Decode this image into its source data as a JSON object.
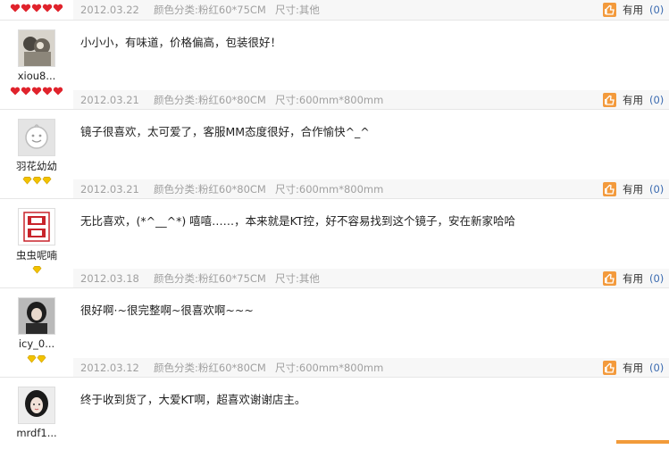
{
  "reviews": [
    {
      "username": "",
      "rank": {
        "type": "heart",
        "count": 5
      },
      "content": "",
      "meta": {
        "date": "2012.03.22",
        "color": "颜色分类:粉红60*75CM",
        "size": "尺寸:其他"
      },
      "useful_label": "有用",
      "useful_count": "(0)"
    },
    {
      "username": "xiou8...",
      "rank": {
        "type": "heart",
        "count": 5
      },
      "content": "小小小，有味道，价格偏高，包装很好！",
      "meta": {
        "date": "2012.03.21",
        "color": "颜色分类:粉红60*80CM",
        "size": "尺寸:600mm*800mm"
      },
      "useful_label": "有用",
      "useful_count": "(0)"
    },
    {
      "username": "羽花幼幼",
      "rank": {
        "type": "diamond",
        "count": 3
      },
      "content": "镜子很喜欢，太可爱了，客服MM态度很好，合作愉快^_^",
      "meta": {
        "date": "2012.03.21",
        "color": "颜色分类:粉红60*80CM",
        "size": "尺寸:600mm*800mm"
      },
      "useful_label": "有用",
      "useful_count": "(0)"
    },
    {
      "username": "虫虫呢喃",
      "rank": {
        "type": "diamond",
        "count": 1
      },
      "content": "无比喜欢，(*^__^*) 嘻嘻……，本来就是KT控，好不容易找到这个镜子，安在新家哈哈",
      "meta": {
        "date": "2012.03.18",
        "color": "颜色分类:粉红60*75CM",
        "size": "尺寸:其他"
      },
      "useful_label": "有用",
      "useful_count": "(0)"
    },
    {
      "username": "icy_0...",
      "rank": {
        "type": "diamond",
        "count": 2
      },
      "content": "很好啊·~很完整啊~很喜欢啊~~~",
      "meta": {
        "date": "2012.03.12",
        "color": "颜色分类:粉红60*80CM",
        "size": "尺寸:600mm*800mm"
      },
      "useful_label": "有用",
      "useful_count": "(0)"
    },
    {
      "username": "mrdf1...",
      "rank": {
        "type": "none",
        "count": 0
      },
      "content": "终于收到货了，大爱KT啊，超喜欢谢谢店主。",
      "meta": {
        "date": "",
        "color": "",
        "size": ""
      },
      "useful_label": "",
      "useful_count": ""
    }
  ],
  "colors": {
    "heart": "#e0232c",
    "diamond": "#f2c200",
    "useful_icon": "#f39a3c",
    "useful_count": "#3a6ab0",
    "meta_text": "#a0a0a0"
  },
  "icons": {
    "useful": "thumbs-up-icon",
    "heart_rank": "heart-icon",
    "diamond_rank": "diamond-icon"
  }
}
